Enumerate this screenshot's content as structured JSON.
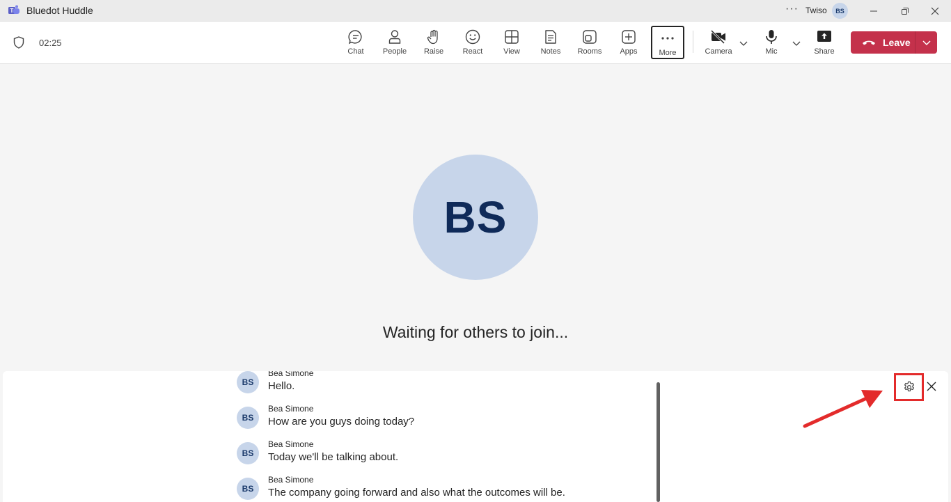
{
  "window": {
    "title": "Bluedot Huddle",
    "user_name": "Twiso",
    "user_initials": "BS"
  },
  "toolbar": {
    "timer": "02:25",
    "tools": [
      {
        "label": "Chat",
        "icon": "chat-icon"
      },
      {
        "label": "People",
        "icon": "people-icon"
      },
      {
        "label": "Raise",
        "icon": "raise-hand-icon"
      },
      {
        "label": "React",
        "icon": "smile-icon"
      },
      {
        "label": "View",
        "icon": "grid-view-icon"
      },
      {
        "label": "Notes",
        "icon": "notes-icon"
      },
      {
        "label": "Rooms",
        "icon": "rooms-icon"
      },
      {
        "label": "Apps",
        "icon": "apps-plus-icon"
      },
      {
        "label": "More",
        "icon": "more-dots-icon"
      }
    ],
    "camera_label": "Camera",
    "mic_label": "Mic",
    "share_label": "Share",
    "leave_label": "Leave",
    "leave_color": "#c4314b"
  },
  "stage": {
    "avatar_initials": "BS",
    "status": "Waiting for others to join..."
  },
  "captions": {
    "items": [
      {
        "initials": "BS",
        "speaker": "Bea Simone",
        "text": "Hello."
      },
      {
        "initials": "BS",
        "speaker": "Bea Simone",
        "text": "How are you guys doing today?"
      },
      {
        "initials": "BS",
        "speaker": "Bea Simone",
        "text": "Today we'll be talking about."
      },
      {
        "initials": "BS",
        "speaker": "Bea Simone",
        "text": "The company going forward and also what the outcomes will be."
      }
    ],
    "highlight_color": "#e32b2b"
  }
}
